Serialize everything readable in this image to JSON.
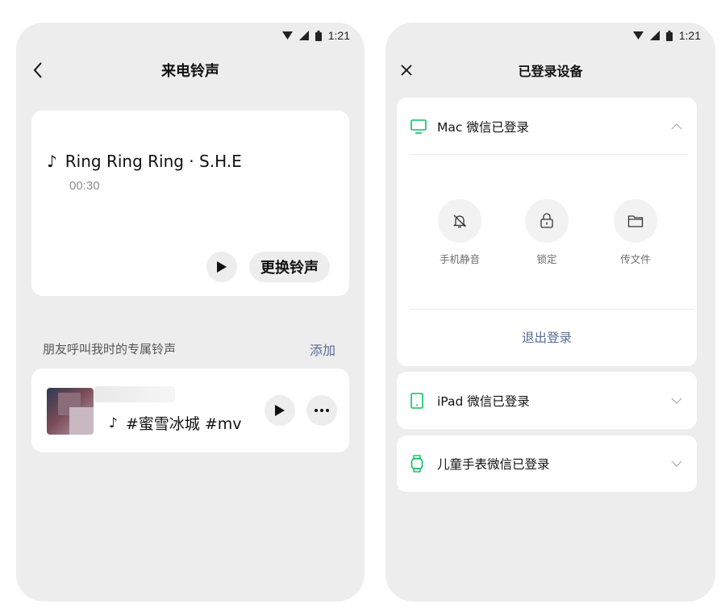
{
  "left": {
    "status_time": "1:21",
    "title": "来电铃声",
    "song": {
      "note": "♪",
      "name": "Ring Ring Ring · S.H.E",
      "duration": "00:30"
    },
    "change_button": "更换铃声",
    "section_label": "朋友呼叫我时的专属铃声",
    "add_link": "添加",
    "friend_item": {
      "note": "♪",
      "tag": "#蜜雪冰城 #mv"
    }
  },
  "right": {
    "status_time": "1:21",
    "title": "已登录设备",
    "devices": [
      {
        "label": "Mac 微信已登录",
        "icon": "monitor-icon"
      },
      {
        "label": "iPad 微信已登录",
        "icon": "tablet-icon"
      },
      {
        "label": "儿童手表微信已登录",
        "icon": "watch-icon"
      }
    ],
    "actions": [
      {
        "label": "手机静音",
        "icon": "bell-off-icon"
      },
      {
        "label": "锁定",
        "icon": "lock-icon"
      },
      {
        "label": "传文件",
        "icon": "folder-icon"
      }
    ],
    "logout": "退出登录"
  },
  "colors": {
    "accent_green": "#07c160",
    "link_blue": "#576b95",
    "background": "#ededed"
  }
}
